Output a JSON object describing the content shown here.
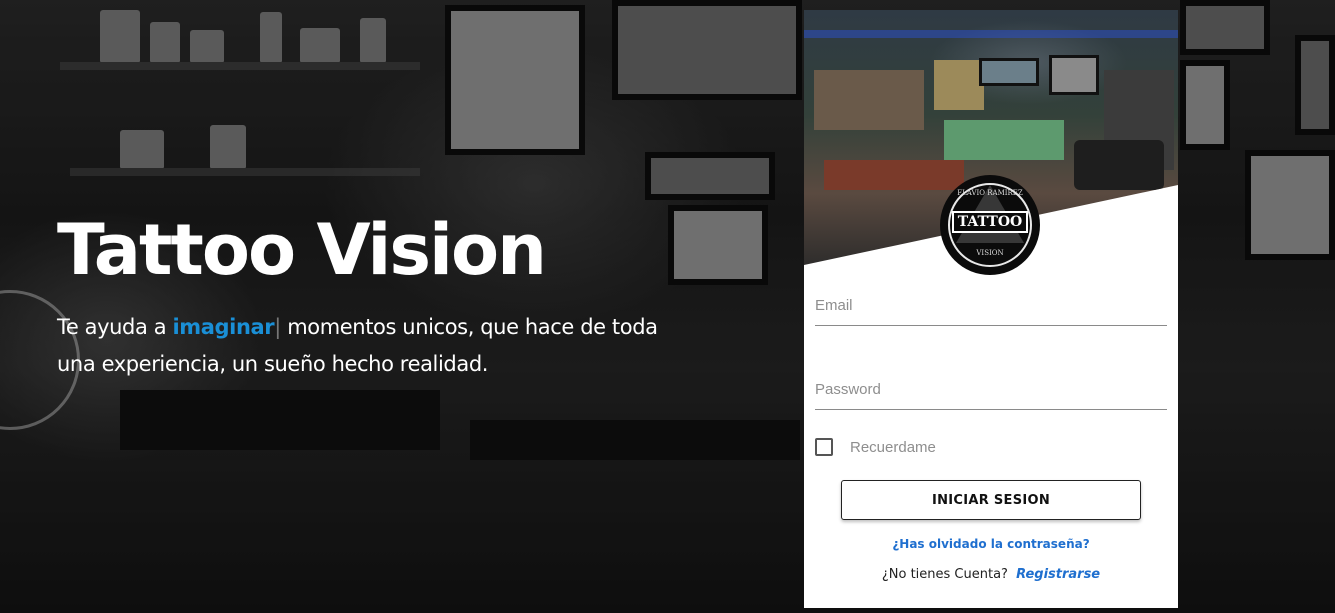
{
  "hero": {
    "title": "Tattoo Vision",
    "tagline_prefix": "Te ayuda a ",
    "tagline_highlight": "imaginar",
    "tagline_caret": "|",
    "tagline_suffix": " momentos unicos, que hace de toda una experiencia, un sueño hecho realidad."
  },
  "login": {
    "logo": {
      "word": "TATTOO",
      "arc_top": "FLAVIO RAMIREZ",
      "arc_bottom": "VISION"
    },
    "email_placeholder": "Email",
    "password_placeholder": "Password",
    "remember_label": "Recuerdame",
    "submit_label": "INICIAR SESION",
    "forgot_label": "¿Has olvidado la contraseña?",
    "signup_prompt": "¿No tienes Cuenta?",
    "signup_label": "Registrarse"
  },
  "colors": {
    "accent": "#1a8fd6",
    "link": "#1f6fcf"
  }
}
